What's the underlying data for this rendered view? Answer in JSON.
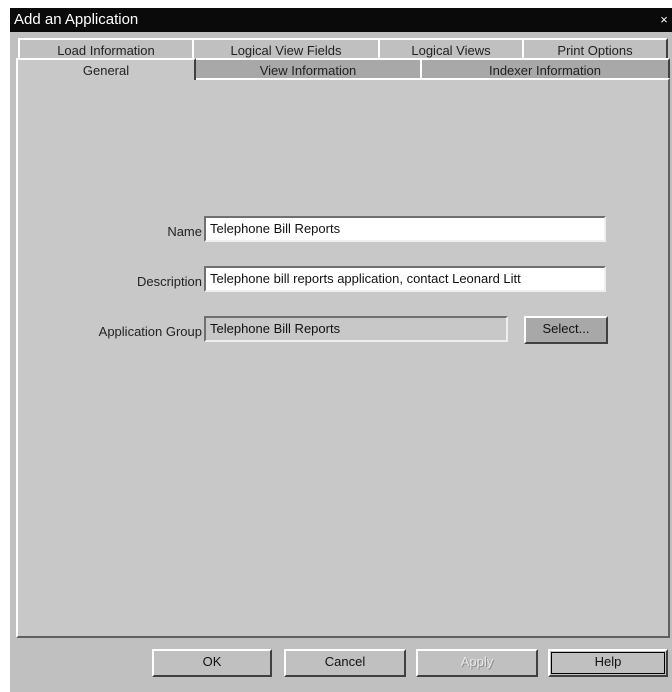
{
  "window": {
    "title": "Add an Application",
    "close_glyph": "×"
  },
  "tabs": {
    "row1": [
      "Load Information",
      "Logical View Fields",
      "Logical Views",
      "Print Options"
    ],
    "row2": [
      "General",
      "View Information",
      "Indexer Information"
    ],
    "active": "General"
  },
  "form": {
    "name_label": "Name",
    "name_value": "Telephone Bill Reports",
    "description_label": "Description",
    "description_value": "Telephone bill reports application, contact Leonard Litt",
    "group_label": "Application Group",
    "group_value": "Telephone Bill Reports",
    "select_label": "Select..."
  },
  "buttons": {
    "ok": "OK",
    "cancel": "Cancel",
    "apply": "Apply",
    "help": "Help"
  }
}
